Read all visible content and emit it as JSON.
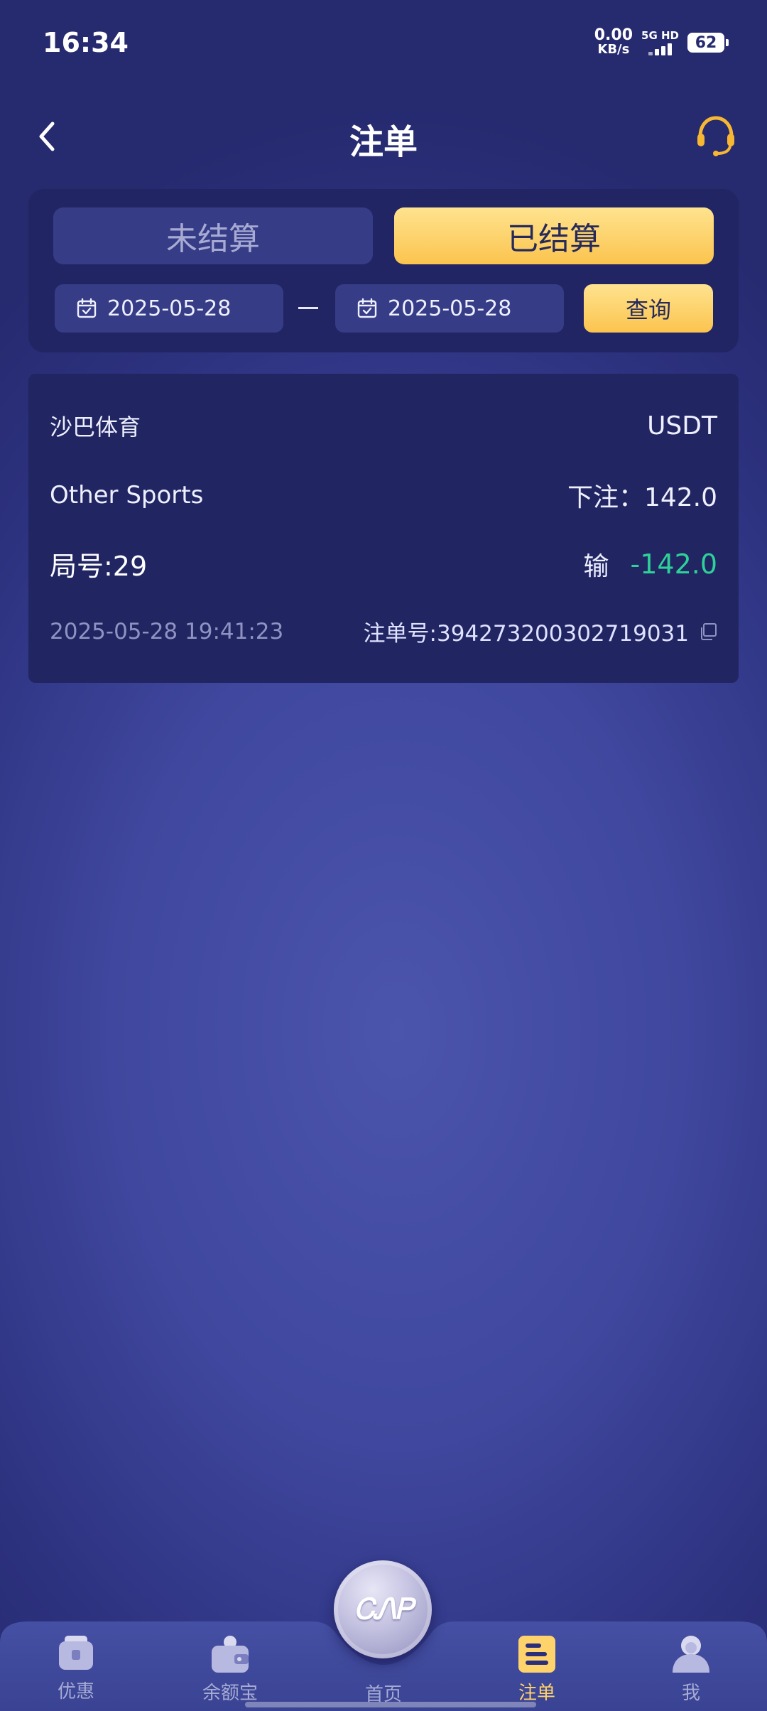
{
  "status_bar": {
    "time": "16:34",
    "net_speed_value": "0.00",
    "net_speed_unit": "KB/s",
    "network_label": "5G HD",
    "battery": "62"
  },
  "header": {
    "title": "注单"
  },
  "filter": {
    "tab_unsettled": "未结算",
    "tab_settled": "已结算",
    "active_tab": "已结算",
    "start_date": "2025-05-28",
    "end_date": "2025-05-28",
    "query_label": "查询"
  },
  "bet": {
    "platform": "沙巴体育",
    "currency": "USDT",
    "sport": "Other Sports",
    "stake_text": "下注：142.0",
    "round_text": "局号:29",
    "result_label": "输",
    "result_amount": "-142.0",
    "result_color": "#2ed199",
    "bet_time": "2025-05-28 19:41:23",
    "order_text": "注单号:394273200302719031"
  },
  "nav": {
    "promo": "优惠",
    "balance": "余额宝",
    "home": "首页",
    "home_logo": "ᏟᏁᏢ",
    "bets": "注单",
    "me": "我",
    "active": "注单",
    "active_color": "#ffd36b"
  }
}
